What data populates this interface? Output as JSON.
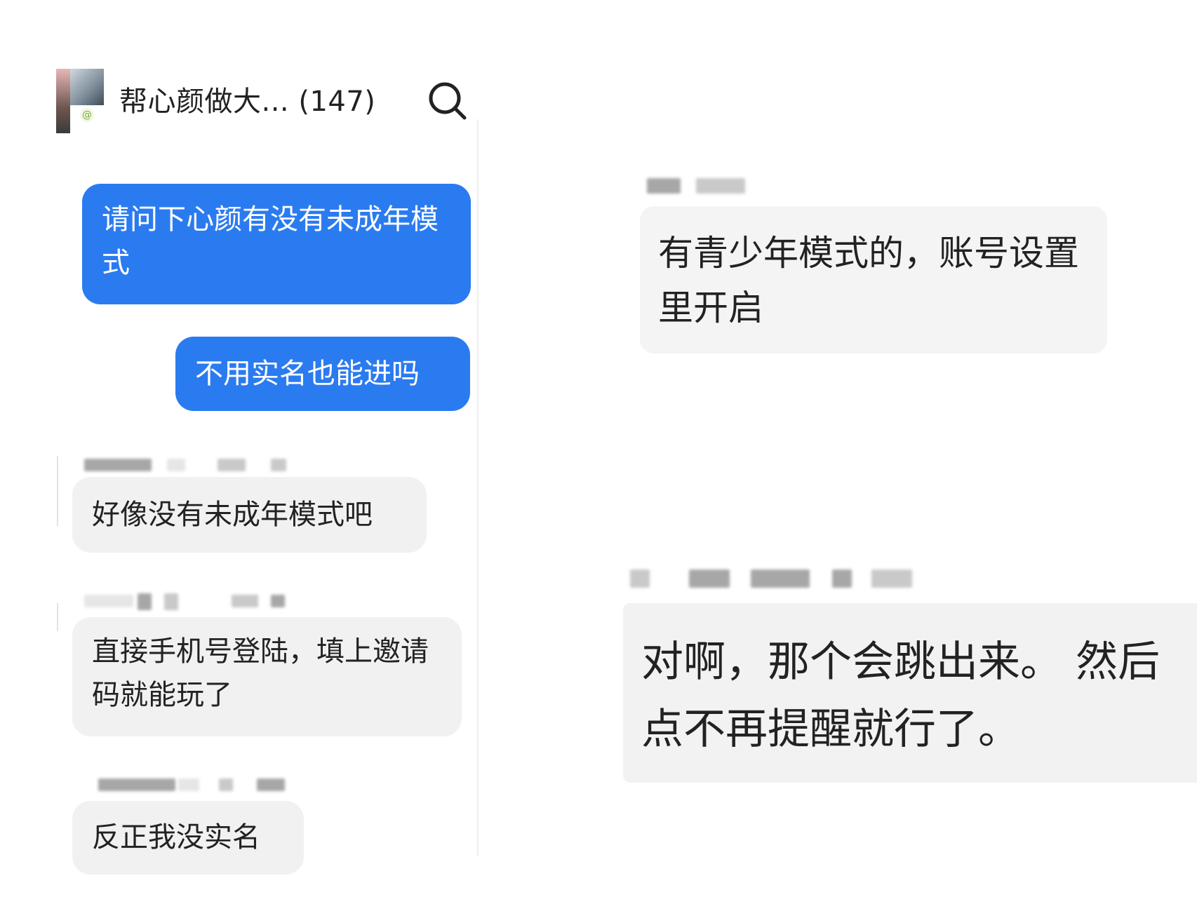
{
  "header": {
    "title": "帮心颜做大... (147)",
    "search_icon": "search-icon"
  },
  "messages_left": [
    {
      "sender": "self",
      "text": "请问下心颜有没有未成年模式"
    },
    {
      "sender": "self",
      "text": "不用实名也能进吗"
    },
    {
      "sender": "other",
      "text": "好像没有未成年模式吧"
    },
    {
      "sender": "other",
      "text": "直接手机号登陆，填上邀请码就能玩了"
    },
    {
      "sender": "other",
      "text": "反正我没实名"
    }
  ],
  "messages_right": [
    {
      "sender": "other",
      "text": "有青少年模式的，账号设置里开启"
    },
    {
      "sender": "other",
      "text": "对啊，那个会跳出来。 然后点不再提醒就行了。"
    }
  ],
  "colors": {
    "self_bubble": "#2b7bf0",
    "other_bubble": "#f1f1f1",
    "background": "#ffffff"
  }
}
